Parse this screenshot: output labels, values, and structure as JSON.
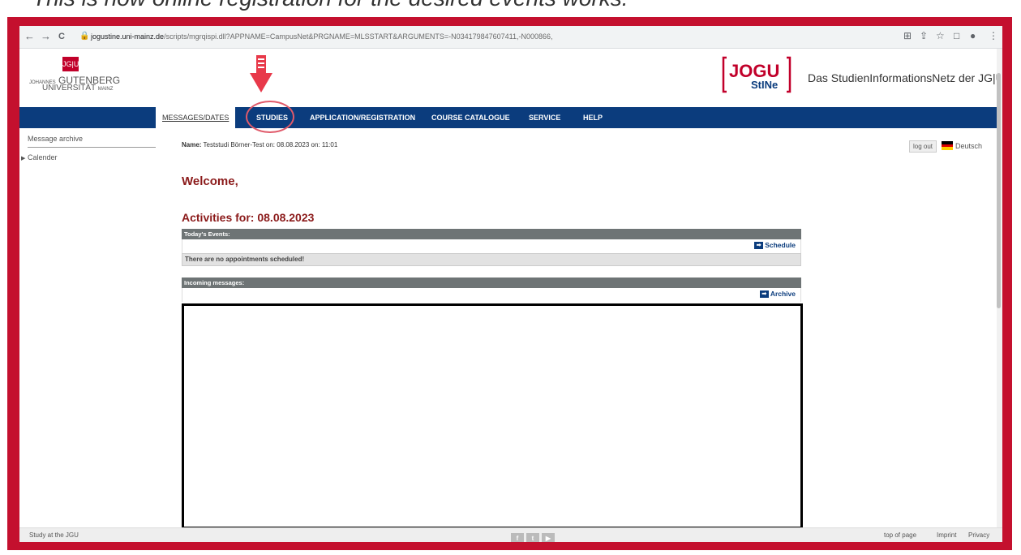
{
  "caption": "This is how online registration for the desired events works:",
  "colors": {
    "frame": "#c4102e",
    "menu": "#0b3c7d",
    "heading": "#8b1a1a",
    "panel_head": "#6e7475"
  },
  "browser": {
    "back_icon": "←",
    "forward_icon": "→",
    "reload_icon": "C",
    "lock_icon": "🔒",
    "url_host": "jogustine.uni-mainz.de",
    "url_path": "/scripts/mgrqispi.dll?APPNAME=CampusNet&PRGNAME=MLSSTART&ARGUMENTS=-N034179847607411,-N000866,",
    "translate_icon": "⊞",
    "share_icon": "⇪",
    "star_icon": "☆",
    "sidepanel_icon": "□",
    "profile_icon": "●",
    "menu_icon": "⋮"
  },
  "header": {
    "logo_box": "JG|U",
    "uni_line1_prefix": "JOHANNES",
    "uni_line1": "GUTENBERG",
    "uni_line2": "UNIVERSITÄT",
    "uni_line2_suffix": "MAINZ",
    "site_title": "Das StudienInformationsNetz der JG|U"
  },
  "menu": {
    "items": [
      "MESSAGES/DATES",
      "STUDIES",
      "APPLICATION/REGISTRATION",
      "COURSE CATALOGUE",
      "SERVICE",
      "HELP"
    ]
  },
  "sidebar": {
    "items": [
      "Message archive",
      "Calender"
    ]
  },
  "main": {
    "name_label": "Name:",
    "name_value": "Teststudi Börner-Test on: 08.08.2023 on: 11:01",
    "logout": "log out",
    "language": "Deutsch",
    "welcome": "Welcome,",
    "activities": "Activities for: 08.08.2023",
    "events_header": "Today's Events:",
    "schedule_button": "Schedule",
    "no_events": "There are no appointments scheduled!",
    "messages_header": "Incoming messages:",
    "archive_button": "Archive"
  },
  "footer": {
    "left": "Study at the JGU",
    "social": [
      "f",
      "t",
      "▶"
    ],
    "top_of_page": "top of page",
    "imprint": "Imprint",
    "privacy": "Privacy"
  }
}
